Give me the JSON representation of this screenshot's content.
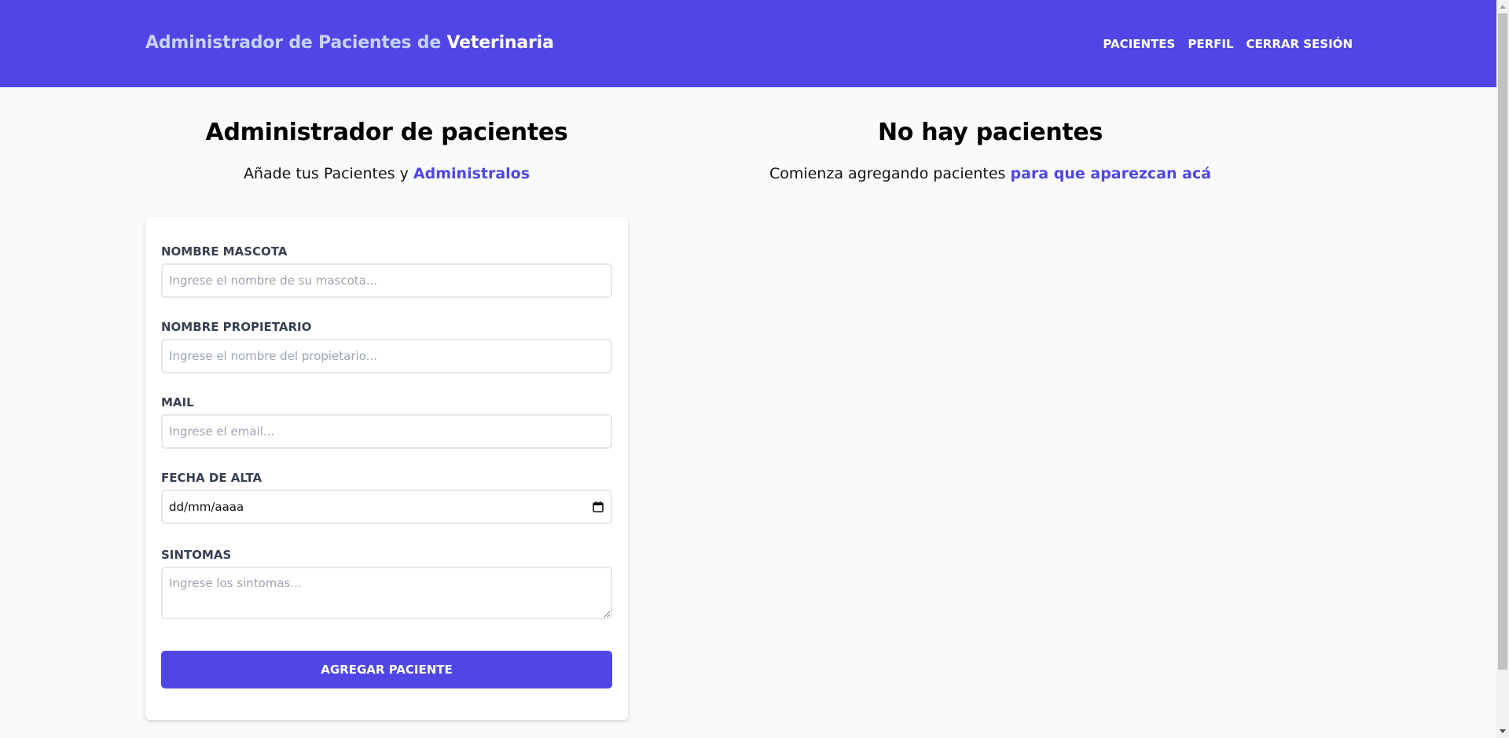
{
  "header": {
    "brand_part1": "Administrador de Pacientes de",
    "brand_part2": "Veterinaria",
    "nav": {
      "pacientes": "Pacientes",
      "perfil": "Perfil",
      "cerrar_sesion": "Cerrar Sesión"
    }
  },
  "form_section": {
    "title": "Administrador de pacientes",
    "subtitle_plain": "Añade tus Pacientes y",
    "subtitle_link": "Administralos",
    "fields": {
      "mascota": {
        "label": "Nombre Mascota",
        "placeholder": "Ingrese el nombre de su mascota..."
      },
      "propietario": {
        "label": "Nombre Propietario",
        "placeholder": "Ingrese el nombre del propietario..."
      },
      "mail": {
        "label": "Mail",
        "placeholder": "Ingrese el email..."
      },
      "fecha": {
        "label": "Fecha de Alta",
        "value": "dd/mm/aaaa"
      },
      "sintomas": {
        "label": "Sintomas",
        "placeholder": "Ingrese los sintomas..."
      }
    },
    "submit_label": "Agregar Paciente"
  },
  "list_section": {
    "title": "No hay pacientes",
    "subtitle_plain": "Comienza agregando pacientes",
    "subtitle_link": "para que aparezcan acá"
  },
  "colors": {
    "primary": "#4f46e5",
    "brand_muted": "#c7d2fe",
    "background": "#f8fafc"
  }
}
